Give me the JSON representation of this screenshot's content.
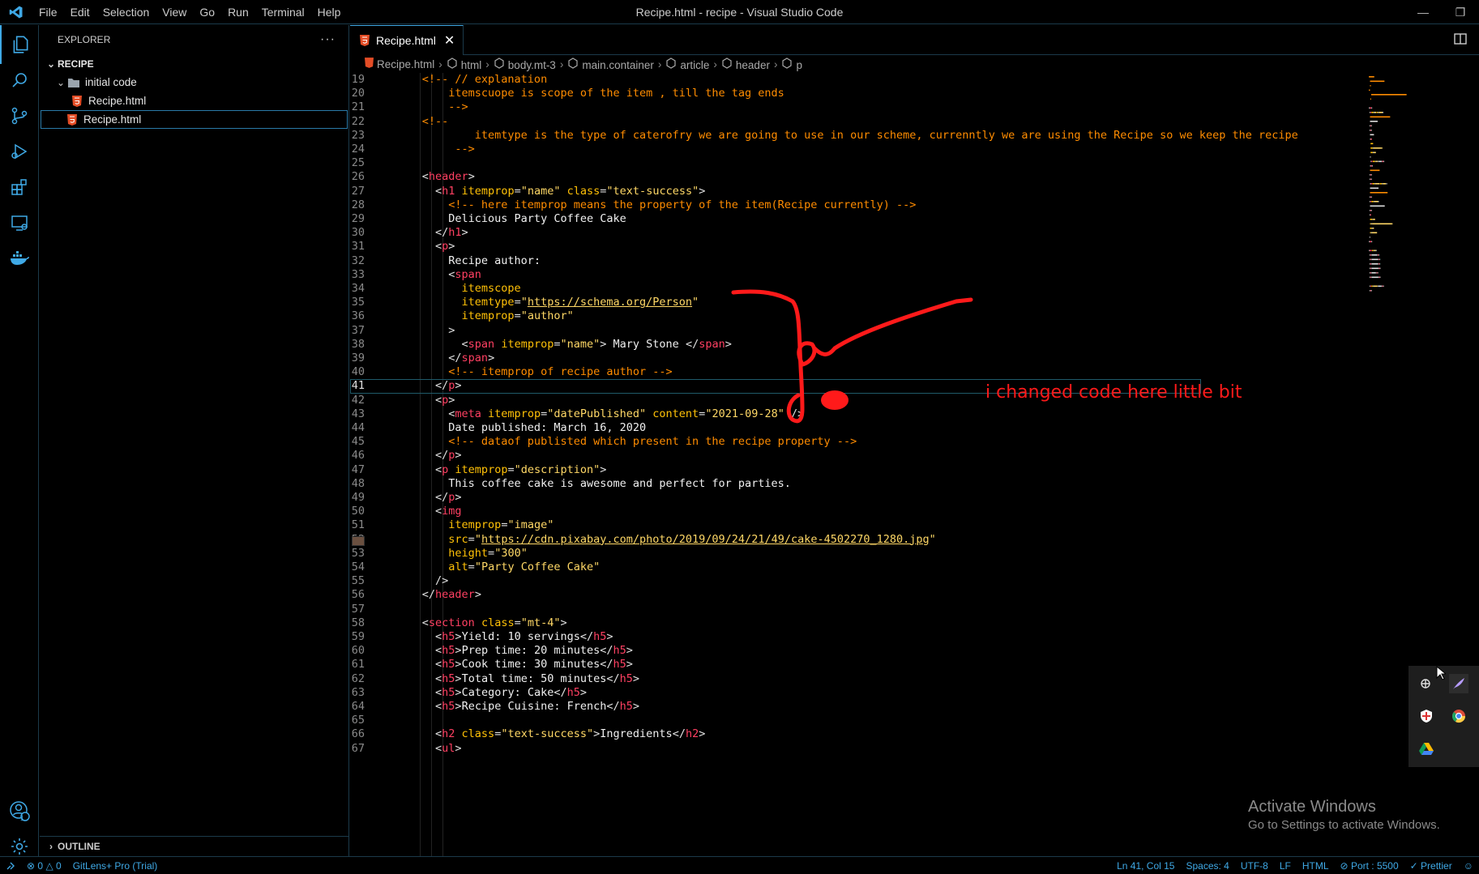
{
  "window": {
    "title": "Recipe.html - recipe - Visual Studio Code",
    "menu": [
      "File",
      "Edit",
      "Selection",
      "View",
      "Go",
      "Run",
      "Terminal",
      "Help"
    ]
  },
  "activity_bar": {
    "items": [
      "files-icon",
      "search-icon",
      "source-control-icon",
      "run-debug-icon",
      "extensions-icon",
      "remote-explorer-icon",
      "docker-icon"
    ],
    "bottom": [
      "accounts-icon",
      "settings-gear-icon"
    ],
    "accounts_badge": "1"
  },
  "sidebar": {
    "header": "EXPLORER",
    "more": "···",
    "root": "RECIPE",
    "folder": "initial code",
    "nested_file": "Recipe.html",
    "root_file": "Recipe.html",
    "outline": "OUTLINE"
  },
  "editor": {
    "tab_label": "Recipe.html",
    "tab_close": "✕",
    "breadcrumb": [
      "Recipe.html",
      "html",
      "body.mt-3",
      "main.container",
      "article",
      "header",
      "p"
    ],
    "current_line": 41
  },
  "code": [
    {
      "n": "19",
      "s": [
        [
          "c-com",
          "      <!-- // explanation"
        ]
      ]
    },
    {
      "n": "20",
      "s": [
        [
          "c-com",
          "          itemscuope is scope of the item , till the tag ends"
        ]
      ]
    },
    {
      "n": "21",
      "s": [
        [
          "c-com",
          "          -->"
        ]
      ]
    },
    {
      "n": "22",
      "s": [
        [
          "c-com",
          "      <!--"
        ]
      ]
    },
    {
      "n": "23",
      "s": [
        [
          "c-com",
          "              itemtype is the type of caterofry we are going to use in our scheme, currenntly we are using the Recipe so we keep the recipe"
        ]
      ]
    },
    {
      "n": "24",
      "s": [
        [
          "c-com",
          "           -->"
        ]
      ]
    },
    {
      "n": "25",
      "s": []
    },
    {
      "n": "26",
      "s": [
        [
          "c-p",
          "      <"
        ],
        [
          "c-tag",
          "header"
        ],
        [
          "c-p",
          ">"
        ]
      ]
    },
    {
      "n": "27",
      "s": [
        [
          "c-p",
          "        <"
        ],
        [
          "c-tag",
          "h1"
        ],
        [
          "c-attr",
          " itemprop"
        ],
        [
          "c-p",
          "="
        ],
        [
          "c-str",
          "\"name\""
        ],
        [
          "c-attr",
          " class"
        ],
        [
          "c-p",
          "="
        ],
        [
          "c-str",
          "\"text-success\""
        ],
        [
          "c-p",
          ">"
        ]
      ]
    },
    {
      "n": "28",
      "s": [
        [
          "c-com",
          "          <!-- here itemprop means the property of the item(Recipe currently) -->"
        ]
      ]
    },
    {
      "n": "29",
      "s": [
        [
          "c-txt",
          "          Delicious Party Coffee Cake"
        ]
      ]
    },
    {
      "n": "30",
      "s": [
        [
          "c-p",
          "        </"
        ],
        [
          "c-tag",
          "h1"
        ],
        [
          "c-p",
          ">"
        ]
      ]
    },
    {
      "n": "31",
      "s": [
        [
          "c-p",
          "        <"
        ],
        [
          "c-tag",
          "p"
        ],
        [
          "c-p",
          ">"
        ]
      ]
    },
    {
      "n": "32",
      "s": [
        [
          "c-txt",
          "          Recipe author:"
        ]
      ]
    },
    {
      "n": "33",
      "s": [
        [
          "c-p",
          "          <"
        ],
        [
          "c-tag",
          "span"
        ]
      ]
    },
    {
      "n": "34",
      "s": [
        [
          "c-attr",
          "            itemscope"
        ]
      ]
    },
    {
      "n": "35",
      "s": [
        [
          "c-attr",
          "            itemtype"
        ],
        [
          "c-p",
          "="
        ],
        [
          "c-str",
          "\""
        ],
        [
          "c-url",
          "https://schema.org/Person"
        ],
        [
          "c-str",
          "\""
        ]
      ]
    },
    {
      "n": "36",
      "s": [
        [
          "c-attr",
          "            itemprop"
        ],
        [
          "c-p",
          "="
        ],
        [
          "c-str",
          "\"author\""
        ]
      ]
    },
    {
      "n": "37",
      "s": [
        [
          "c-p",
          "          >"
        ]
      ]
    },
    {
      "n": "38",
      "s": [
        [
          "c-p",
          "            <"
        ],
        [
          "c-tag",
          "span"
        ],
        [
          "c-attr",
          " itemprop"
        ],
        [
          "c-p",
          "="
        ],
        [
          "c-str",
          "\"name\""
        ],
        [
          "c-p",
          ">"
        ],
        [
          "c-txt",
          " Mary Stone "
        ],
        [
          "c-p",
          "</"
        ],
        [
          "c-tag",
          "span"
        ],
        [
          "c-p",
          ">"
        ]
      ]
    },
    {
      "n": "39",
      "s": [
        [
          "c-p",
          "          </"
        ],
        [
          "c-tag",
          "span"
        ],
        [
          "c-p",
          ">"
        ]
      ]
    },
    {
      "n": "40",
      "s": [
        [
          "c-com",
          "          <!-- itemprop of recipe author -->"
        ]
      ]
    },
    {
      "n": "41",
      "s": [
        [
          "c-p",
          "        </"
        ],
        [
          "c-tag",
          "p"
        ],
        [
          "c-p",
          ">"
        ]
      ]
    },
    {
      "n": "42",
      "s": [
        [
          "c-p",
          "        <"
        ],
        [
          "c-tag",
          "p"
        ],
        [
          "c-p",
          ">"
        ]
      ]
    },
    {
      "n": "43",
      "s": [
        [
          "c-p",
          "          <"
        ],
        [
          "c-tag",
          "meta"
        ],
        [
          "c-attr",
          " itemprop"
        ],
        [
          "c-p",
          "="
        ],
        [
          "c-str",
          "\"datePublished\""
        ],
        [
          "c-attr",
          " content"
        ],
        [
          "c-p",
          "="
        ],
        [
          "c-str",
          "\"2021-09-28\""
        ],
        [
          "c-p",
          " />"
        ]
      ]
    },
    {
      "n": "44",
      "s": [
        [
          "c-txt",
          "          Date published: March 16, 2020"
        ]
      ]
    },
    {
      "n": "45",
      "s": [
        [
          "c-com",
          "          <!-- dataof publisted which present in the recipe property -->"
        ]
      ]
    },
    {
      "n": "46",
      "s": [
        [
          "c-p",
          "        </"
        ],
        [
          "c-tag",
          "p"
        ],
        [
          "c-p",
          ">"
        ]
      ]
    },
    {
      "n": "47",
      "s": [
        [
          "c-p",
          "        <"
        ],
        [
          "c-tag",
          "p"
        ],
        [
          "c-attr",
          " itemprop"
        ],
        [
          "c-p",
          "="
        ],
        [
          "c-str",
          "\"description\""
        ],
        [
          "c-p",
          ">"
        ]
      ]
    },
    {
      "n": "48",
      "s": [
        [
          "c-txt",
          "          This coffee cake is awesome and perfect for parties."
        ]
      ]
    },
    {
      "n": "49",
      "s": [
        [
          "c-p",
          "        </"
        ],
        [
          "c-tag",
          "p"
        ],
        [
          "c-p",
          ">"
        ]
      ]
    },
    {
      "n": "50",
      "s": [
        [
          "c-p",
          "        <"
        ],
        [
          "c-tag",
          "img"
        ]
      ]
    },
    {
      "n": "51",
      "s": [
        [
          "c-attr",
          "          itemprop"
        ],
        [
          "c-p",
          "="
        ],
        [
          "c-str",
          "\"image\""
        ]
      ]
    },
    {
      "n": "52",
      "s": [
        [
          "c-attr",
          "          src"
        ],
        [
          "c-p",
          "="
        ],
        [
          "c-str",
          "\""
        ],
        [
          "c-url",
          "https://cdn.pixabay.com/photo/2019/09/24/21/49/cake-4502270_1280.jpg"
        ],
        [
          "c-str",
          "\""
        ]
      ]
    },
    {
      "n": "53",
      "s": [
        [
          "c-attr",
          "          height"
        ],
        [
          "c-p",
          "="
        ],
        [
          "c-str",
          "\"300\""
        ]
      ]
    },
    {
      "n": "54",
      "s": [
        [
          "c-attr",
          "          alt"
        ],
        [
          "c-p",
          "="
        ],
        [
          "c-str",
          "\"Party Coffee Cake\""
        ]
      ]
    },
    {
      "n": "55",
      "s": [
        [
          "c-p",
          "        />"
        ]
      ]
    },
    {
      "n": "56",
      "s": [
        [
          "c-p",
          "      </"
        ],
        [
          "c-tag",
          "header"
        ],
        [
          "c-p",
          ">"
        ]
      ]
    },
    {
      "n": "57",
      "s": []
    },
    {
      "n": "58",
      "s": [
        [
          "c-p",
          "      <"
        ],
        [
          "c-tag",
          "section"
        ],
        [
          "c-attr",
          " class"
        ],
        [
          "c-p",
          "="
        ],
        [
          "c-str",
          "\"mt-4\""
        ],
        [
          "c-p",
          ">"
        ]
      ]
    },
    {
      "n": "59",
      "s": [
        [
          "c-p",
          "        <"
        ],
        [
          "c-tag",
          "h5"
        ],
        [
          "c-p",
          ">"
        ],
        [
          "c-txt",
          "Yield: 10 servings"
        ],
        [
          "c-p",
          "</"
        ],
        [
          "c-tag",
          "h5"
        ],
        [
          "c-p",
          ">"
        ]
      ]
    },
    {
      "n": "60",
      "s": [
        [
          "c-p",
          "        <"
        ],
        [
          "c-tag",
          "h5"
        ],
        [
          "c-p",
          ">"
        ],
        [
          "c-txt",
          "Prep time: 20 minutes"
        ],
        [
          "c-p",
          "</"
        ],
        [
          "c-tag",
          "h5"
        ],
        [
          "c-p",
          ">"
        ]
      ]
    },
    {
      "n": "61",
      "s": [
        [
          "c-p",
          "        <"
        ],
        [
          "c-tag",
          "h5"
        ],
        [
          "c-p",
          ">"
        ],
        [
          "c-txt",
          "Cook time: 30 minutes"
        ],
        [
          "c-p",
          "</"
        ],
        [
          "c-tag",
          "h5"
        ],
        [
          "c-p",
          ">"
        ]
      ]
    },
    {
      "n": "62",
      "s": [
        [
          "c-p",
          "        <"
        ],
        [
          "c-tag",
          "h5"
        ],
        [
          "c-p",
          ">"
        ],
        [
          "c-txt",
          "Total time: 50 minutes"
        ],
        [
          "c-p",
          "</"
        ],
        [
          "c-tag",
          "h5"
        ],
        [
          "c-p",
          ">"
        ]
      ]
    },
    {
      "n": "63",
      "s": [
        [
          "c-p",
          "        <"
        ],
        [
          "c-tag",
          "h5"
        ],
        [
          "c-p",
          ">"
        ],
        [
          "c-txt",
          "Category: Cake"
        ],
        [
          "c-p",
          "</"
        ],
        [
          "c-tag",
          "h5"
        ],
        [
          "c-p",
          ">"
        ]
      ]
    },
    {
      "n": "64",
      "s": [
        [
          "c-p",
          "        <"
        ],
        [
          "c-tag",
          "h5"
        ],
        [
          "c-p",
          ">"
        ],
        [
          "c-txt",
          "Recipe Cuisine: French"
        ],
        [
          "c-p",
          "</"
        ],
        [
          "c-tag",
          "h5"
        ],
        [
          "c-p",
          ">"
        ]
      ]
    },
    {
      "n": "65",
      "s": []
    },
    {
      "n": "66",
      "s": [
        [
          "c-p",
          "        <"
        ],
        [
          "c-tag",
          "h2"
        ],
        [
          "c-attr",
          " class"
        ],
        [
          "c-p",
          "="
        ],
        [
          "c-str",
          "\"text-success\""
        ],
        [
          "c-p",
          ">"
        ],
        [
          "c-txt",
          "Ingredients"
        ],
        [
          "c-p",
          "</"
        ],
        [
          "c-tag",
          "h2"
        ],
        [
          "c-p",
          ">"
        ]
      ]
    },
    {
      "n": "67",
      "s": [
        [
          "c-p",
          "        <"
        ],
        [
          "c-tag",
          "ul"
        ],
        [
          "c-p",
          ">"
        ]
      ]
    }
  ],
  "annotation": {
    "text": "i changed code here little bit",
    "color": "#ff1a1a"
  },
  "status_bar": {
    "errors": "0",
    "warnings": "0",
    "gitlens": "GitLens+ Pro (Trial)",
    "position": "Ln 41, Col 15",
    "spaces": "Spaces: 4",
    "encoding": "UTF-8",
    "eol": "LF",
    "language": "HTML",
    "port": "Port : 5500",
    "prettier": "Prettier"
  },
  "watermark": {
    "line1": "Activate Windows",
    "line2": "Go to Settings to activate Windows."
  },
  "colors": {
    "accent": "#3fa9e6",
    "tag": "#ff4062",
    "attr": "#ffc107",
    "comment": "#ff8c00"
  }
}
